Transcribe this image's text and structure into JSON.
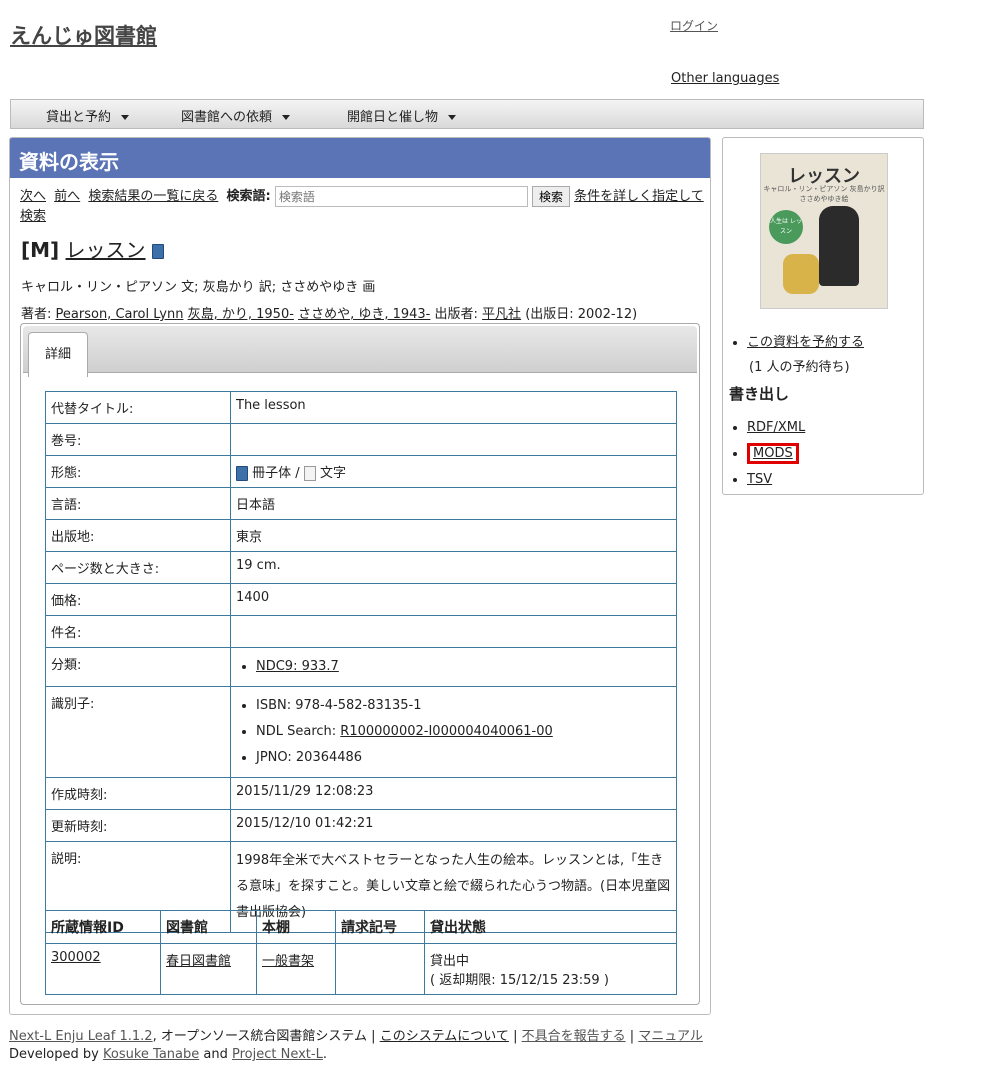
{
  "header": {
    "site_title": "えんじゅ図書館",
    "login": "ログイン",
    "other_languages": "Other languages"
  },
  "nav": {
    "items": [
      {
        "label": "貸出と予約"
      },
      {
        "label": "図書館への依頼"
      },
      {
        "label": "開館日と催し物"
      }
    ]
  },
  "main": {
    "heading": "資料の表示",
    "controls": {
      "next": "次へ",
      "prev": "前へ",
      "back_to_results": "検索結果の一覧に戻る",
      "search_label": "検索語:",
      "search_placeholder": "検索語",
      "search_button": "検索",
      "advanced_search": "条件を詳しく指定して検索"
    },
    "item": {
      "badge": "[M]",
      "title": "レッスン",
      "statement": "キャロル・リン・ピアソン 文; 灰島かり 訳; ささめやゆき 画",
      "creator_label": "著者:",
      "creators": [
        "Pearson, Carol Lynn",
        "灰島, かり, 1950-",
        "ささめや, ゆき, 1943-"
      ],
      "publisher_label": "出版者:",
      "publisher": "平凡社",
      "pub_date": "(出版日: 2002-12)"
    },
    "tab_label": "詳細",
    "details": {
      "alt_title_label": "代替タイトル:",
      "alt_title": "The lesson",
      "volume_label": "巻号:",
      "volume": "",
      "form_label": "形態:",
      "form_1": "冊子体",
      "form_sep": "/",
      "form_2": "文字",
      "language_label": "言語:",
      "language": "日本語",
      "place_label": "出版地:",
      "place": "東京",
      "pages_label": "ページ数と大きさ:",
      "pages": "19 cm.",
      "price_label": "価格:",
      "price": "1400",
      "subject_label": "件名:",
      "subject": "",
      "classification_label": "分類:",
      "classification": "NDC9: 933.7",
      "identifier_label": "識別子:",
      "isbn": "ISBN: 978-4-582-83135-1",
      "ndl_label": "NDL Search:",
      "ndl_value": "R100000002-I000004040061-00",
      "jpno": "JPNO: 20364486",
      "created_label": "作成時刻:",
      "created": "2015/11/29 12:08:23",
      "updated_label": "更新時刻:",
      "updated": "2015/12/10 01:42:21",
      "description_label": "説明:",
      "description": "1998年全米で大ベストセラーとなった人生の絵本。レッスンとは,「生きる意味」を探すこと。美しい文章と絵で綴られた心うつ物語。(日本児童図書出版協会)"
    },
    "items_table": {
      "headers": [
        "所蔵情報ID",
        "図書館",
        "本棚",
        "請求記号",
        "貸出状態"
      ],
      "rows": [
        {
          "id": "300002",
          "library": "春日図書館",
          "shelf": "一般書架",
          "call_number": "",
          "status": "貸出中",
          "due": "( 返却期限: 15/12/15 23:59 )"
        }
      ]
    }
  },
  "sidebar": {
    "cover": {
      "title": "レッスン",
      "sub": "キャロル・リン・ピアソン 灰島かり訳 ささめやゆき絵",
      "circle": "人生は レッスン"
    },
    "reserve_link": "この資料を予約する",
    "reserve_waiting": "(1 人の予約待ち)",
    "export_heading": "書き出し",
    "exports": [
      "RDF/XML",
      "MODS",
      "TSV"
    ]
  },
  "footer": {
    "product": "Next-L Enju Leaf 1.1.2",
    "tagline": ", オープンソース統合図書館システム",
    "sep": "|",
    "about": "このシステムについて",
    "report": "不具合を報告する",
    "manual": "マニュアル",
    "developed_by": "Developed by",
    "author": "Kosuke Tanabe",
    "and": "and",
    "project": "Project Next-L",
    "period": "."
  }
}
